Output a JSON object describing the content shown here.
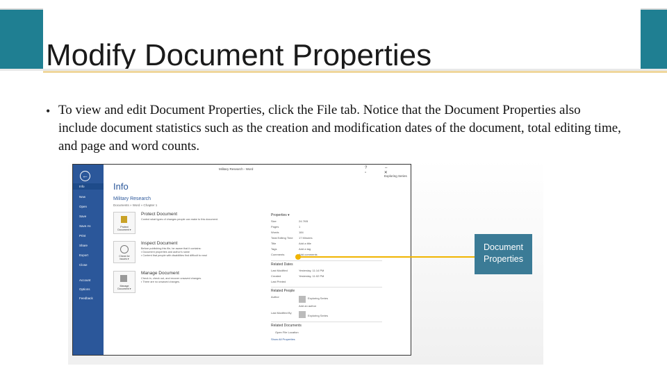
{
  "slide": {
    "title": "Modify Document Properties",
    "bullet": "To view and edit Document Properties, click the File tab. Notice that the Document Properties also include document statistics such as the creation and modification dates of the document, total editing time, and page and word counts.",
    "callout": "Document Properties",
    "colors": {
      "title_band": "#1f7f92",
      "callout": "#3b7b96",
      "callout_line": "#f0b400",
      "word_sidebar": "#2b579a"
    }
  },
  "word": {
    "window_title": "Military Research - Word",
    "window_controls": "? – ▫ ✕",
    "user": "Exploring Series",
    "back_icon": "arrow-left-icon",
    "menu": [
      "Info",
      "New",
      "Open",
      "Save",
      "Save As",
      "Print",
      "Share",
      "Export",
      "Close",
      "Account",
      "Options",
      "Feedback"
    ],
    "info_heading": "Info",
    "doc_name": "Military Research",
    "doc_path": "Documents » Word » Chapter 1",
    "sections": [
      {
        "button_line1": "Protect",
        "button_line2": "Document ▾",
        "heading": "Protect Document",
        "desc": "Control what types of changes people can make to this document."
      },
      {
        "button_line1": "Check for",
        "button_line2": "Issues ▾",
        "heading": "Inspect Document",
        "desc": "Before publishing this file, be aware that it contains:",
        "items": [
          "Document properties and author's name",
          "Content that people with disabilities find difficult to read"
        ]
      },
      {
        "button_line1": "Manage",
        "button_line2": "Document ▾",
        "heading": "Manage Document",
        "desc": "Check in, check out, and recover unsaved changes.",
        "items": [
          "There are no unsaved changes."
        ]
      }
    ],
    "properties": {
      "heading": "Properties ▾",
      "rows": [
        {
          "k": "Size",
          "v": "24.7KB"
        },
        {
          "k": "Pages",
          "v": "1"
        },
        {
          "k": "Words",
          "v": "184"
        },
        {
          "k": "Total Editing Time",
          "v": "17 Minutes"
        },
        {
          "k": "Title",
          "v": "Add a title"
        },
        {
          "k": "Tags",
          "v": "Add a tag"
        },
        {
          "k": "Comments",
          "v": "Add comments"
        }
      ],
      "dates_heading": "Related Dates",
      "dates": [
        {
          "k": "Last Modified",
          "v": "Yesterday, 11:14 PM"
        },
        {
          "k": "Created",
          "v": "Yesterday, 11:02 PM"
        },
        {
          "k": "Last Printed",
          "v": ""
        }
      ],
      "people_heading": "Related People",
      "author_label": "Author",
      "author": "Exploring Series",
      "add_author": "Add an author",
      "modified_by_label": "Last Modified By",
      "modified_by": "Exploring Series",
      "docs_heading": "Related Documents",
      "open_location": "Open File Location",
      "show_all": "Show All Properties"
    }
  }
}
